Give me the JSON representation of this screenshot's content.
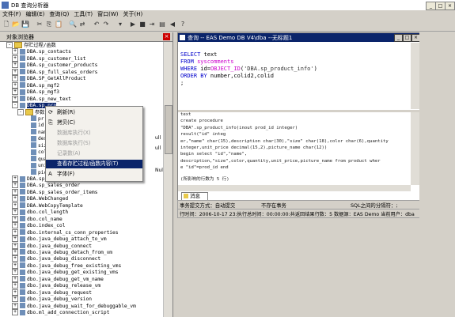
{
  "app": {
    "title": "DB 查询分析器"
  },
  "menu": [
    "文件(F)",
    "编辑(E)",
    "查询(Q)",
    "工具(T)",
    "窗口(W)",
    "关于(H)"
  ],
  "left_panel": {
    "title": "对象浏览器",
    "tree": [
      {
        "label": "存贮过程/函数",
        "type": "folder",
        "indent": 2,
        "pm": "-"
      },
      {
        "label": "DBA.sp_contacts",
        "indent": 3,
        "pm": "+"
      },
      {
        "label": "DBA.sp_customer_list",
        "indent": 3,
        "pm": "+"
      },
      {
        "label": "DBA.sp_customer_products",
        "indent": 3,
        "pm": "+"
      },
      {
        "label": "DBA.sp_full_sales_orders",
        "indent": 3,
        "pm": "+"
      },
      {
        "label": "DBA.SP_GetAllProduct",
        "indent": 3,
        "pm": "+"
      },
      {
        "label": "DBA.sp_mgf2",
        "indent": 3,
        "pm": "+"
      },
      {
        "label": "DBA.sp_mgf3",
        "indent": 3,
        "pm": "+"
      },
      {
        "label": "DBA.sp_new_text",
        "indent": 3,
        "pm": "+"
      },
      {
        "label": "DBA.sp_pro",
        "indent": 3,
        "pm": "-",
        "selected": true
      },
      {
        "label": "参数",
        "type": "folder",
        "indent": 4,
        "pm": "-"
      },
      {
        "label": "pr",
        "indent": 5
      },
      {
        "label": "id",
        "indent": 5
      },
      {
        "label": "nam",
        "indent": 5
      },
      {
        "label": "des",
        "indent": 5
      },
      {
        "label": "siz",
        "indent": 5
      },
      {
        "label": "col",
        "indent": 5
      },
      {
        "label": "qua",
        "indent": 5
      },
      {
        "label": "uni",
        "indent": 5
      },
      {
        "label": "pic",
        "indent": 5
      },
      {
        "label": "DBA.sp_retrieve_contacts",
        "indent": 3,
        "pm": "+"
      },
      {
        "label": "DBA.sp_sales_order",
        "indent": 3,
        "pm": "+"
      },
      {
        "label": "DBA.sp_sales_order_items",
        "indent": 3,
        "pm": "+"
      },
      {
        "label": "DBA.WebChanged",
        "indent": 3,
        "pm": "+"
      },
      {
        "label": "DBA.WebCopyTemplate",
        "indent": 3,
        "pm": "+"
      },
      {
        "label": "dbo.col_length",
        "indent": 3,
        "pm": "+"
      },
      {
        "label": "dbo.col_name",
        "indent": 3,
        "pm": "+"
      },
      {
        "label": "dbo.index_col",
        "indent": 3,
        "pm": "+"
      },
      {
        "label": "dbo.internal_cs_conn_properties",
        "indent": 3,
        "pm": "+"
      },
      {
        "label": "dbo.java_debug_attach_to_vm",
        "indent": 3,
        "pm": "+"
      },
      {
        "label": "dbo.java_debug_connect",
        "indent": 3,
        "pm": "+"
      },
      {
        "label": "dbo.java_debug_detach_from_vm",
        "indent": 3,
        "pm": "+"
      },
      {
        "label": "dbo.java_debug_disconnect",
        "indent": 3,
        "pm": "+"
      },
      {
        "label": "dbo.java_debug_free_existing_vms",
        "indent": 3,
        "pm": "+"
      },
      {
        "label": "dbo.java_debug_get_existing_vms",
        "indent": 3,
        "pm": "+"
      },
      {
        "label": "dbo.java_debug_get_vm_name",
        "indent": 3,
        "pm": "+"
      },
      {
        "label": "dbo.java_debug_release_vm",
        "indent": 3,
        "pm": "+"
      },
      {
        "label": "dbo.java_debug_request",
        "indent": 3,
        "pm": "+"
      },
      {
        "label": "dbo.java_debug_version",
        "indent": 3,
        "pm": "+"
      },
      {
        "label": "dbo.java_debug_wait_for_debuggable_vm",
        "indent": 3,
        "pm": "+"
      },
      {
        "label": "dbo.ml_add_connection_script",
        "indent": 3,
        "pm": "+"
      }
    ],
    "tree_side_text": [
      "ull",
      "ull",
      "Nul"
    ]
  },
  "context_menu": {
    "items": [
      {
        "label": "刷新(R)",
        "icon": "refresh-icon",
        "disabled": false
      },
      {
        "label": "拷贝(C)",
        "icon": "copy-icon",
        "disabled": false
      },
      {
        "label": "数据库执行(X)",
        "icon": "",
        "disabled": true
      },
      {
        "label": "数据库执行(S)",
        "icon": "",
        "disabled": true
      },
      {
        "label": "记录数(A)",
        "icon": "",
        "disabled": true
      },
      {
        "label": "查看存贮过程/函数内容(T)",
        "icon": "",
        "disabled": false,
        "highlighted": true
      },
      {
        "label": "字体(F)",
        "icon": "font-icon",
        "disabled": false
      }
    ]
  },
  "query_window": {
    "title": "查询 -- EAS Demo DB V4\\dba --无标题1",
    "sql": [
      "SELECT  text",
      "FROM  syscomments",
      "WHERE  id=OBJECT_ID('DBA.sp_product_info')",
      "ORDER  BY  number,colid2,colid",
      ";"
    ],
    "results": [
      "text",
      "create procedure",
      "\"DBA\".sp_product_info(inout prod_id integer)",
      "result(\"id\" integ",
      "er,\"name\" char(15),description char(30),\"size\" char(18),color char(6),quantity",
      " integer,unit_price decimal(15,2),picture_name char(12))",
      "begin select \"id\",\"name\",",
      " description,\"size\",color,quantity,unit_price,picture_name from product wher",
      "e \"id\"=prod_id end",
      "(所影响的行数为 5 行)"
    ],
    "tab_label": "消息"
  },
  "status": {
    "transaction": "事务提交方式：自动提交",
    "ignore": "不存在事务",
    "separator": "SQL之间的分隔符：;",
    "line2": "行时间：2006-10-17 23:执行总时间：00:00:00:共返回结果行数：5 数据源：EAS Demo 当前用户：dba"
  }
}
